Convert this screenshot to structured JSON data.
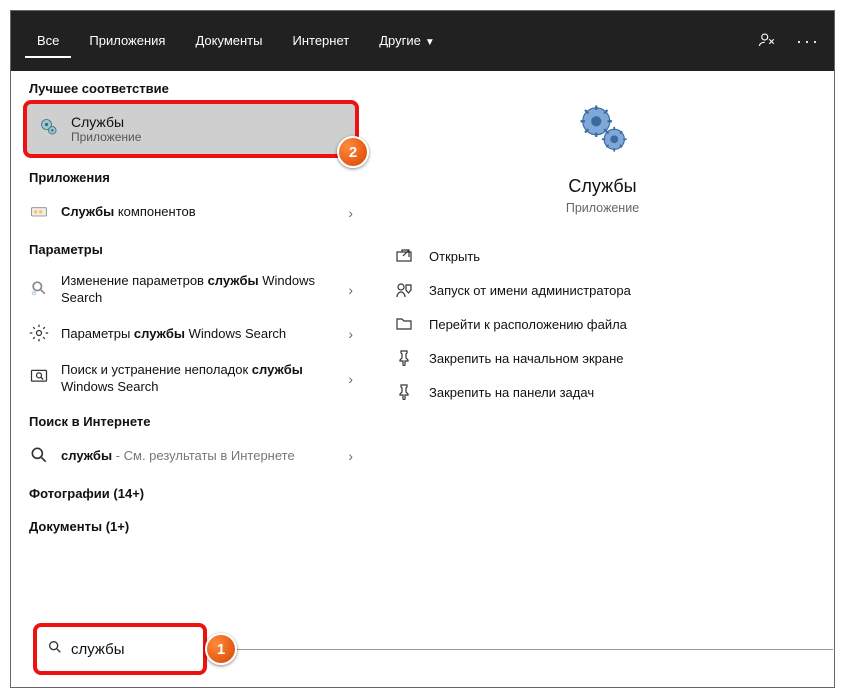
{
  "tabs": {
    "all": "Все",
    "apps": "Приложения",
    "docs": "Документы",
    "web": "Интернет",
    "more": "Другие"
  },
  "sections": {
    "best_match": "Лучшее соответствие",
    "apps": "Приложения",
    "settings": "Параметры",
    "web": "Поиск в Интернете",
    "photos": "Фотографии (14+)",
    "documents": "Документы (1+)"
  },
  "best": {
    "title": "Службы",
    "subtitle": "Приложение"
  },
  "rows": {
    "component_services_pre": "Службы",
    "component_services_post": " компонентов",
    "change_search_pre": "Изменение параметров ",
    "change_search_bold": "службы",
    "change_search_post": " Windows Search",
    "params_search_pre": "Параметры ",
    "params_search_bold": "службы",
    "params_search_post": " Windows Search",
    "trouble_pre": "Поиск и устранение неполадок ",
    "trouble_bold": "службы",
    "trouble_post": " Windows Search",
    "web_bold": "службы",
    "web_dim": " - См. результаты в Интернете"
  },
  "preview": {
    "title": "Службы",
    "subtitle": "Приложение"
  },
  "actions": {
    "open": "Открыть",
    "run_admin": "Запуск от имени администратора",
    "file_location": "Перейти к расположению файла",
    "pin_start": "Закрепить на начальном экране",
    "pin_taskbar": "Закрепить на панели задач"
  },
  "search": {
    "value": "службы"
  },
  "callouts": {
    "one": "1",
    "two": "2"
  }
}
